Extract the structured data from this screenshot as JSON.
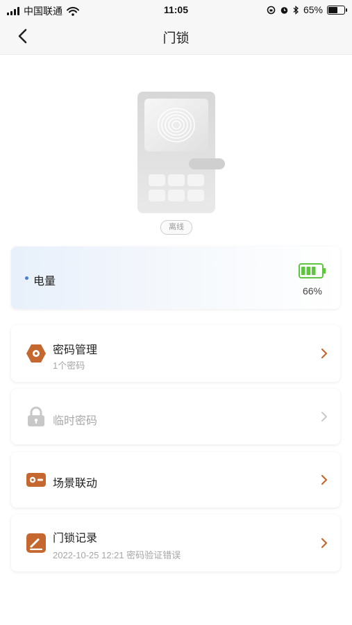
{
  "status_bar": {
    "carrier": "中国联通",
    "time": "11:05",
    "battery_percent": "65%",
    "battery_level": 0.65
  },
  "nav": {
    "title": "门锁",
    "back_icon": "chevron-left-icon"
  },
  "device": {
    "status": "离线"
  },
  "battery_card": {
    "label": "电量",
    "percent": "66%",
    "level": 0.66,
    "color": "#5fc43f"
  },
  "menu": {
    "password_management": {
      "title": "密码管理",
      "subtitle": "1个密码",
      "icon": "hexagon-key-icon"
    },
    "temporary_password": {
      "title": "临时密码",
      "icon": "lock-icon"
    },
    "scene_linkage": {
      "title": "场景联动",
      "icon": "scene-card-icon"
    },
    "lock_records": {
      "title": "门锁记录",
      "subtitle": "2022-10-25 12:21 密码验证错误",
      "icon": "record-pen-icon"
    }
  },
  "colors": {
    "accent": "#c4682f",
    "disabled": "#c8c8c8",
    "dot": "#4a7fd6"
  }
}
